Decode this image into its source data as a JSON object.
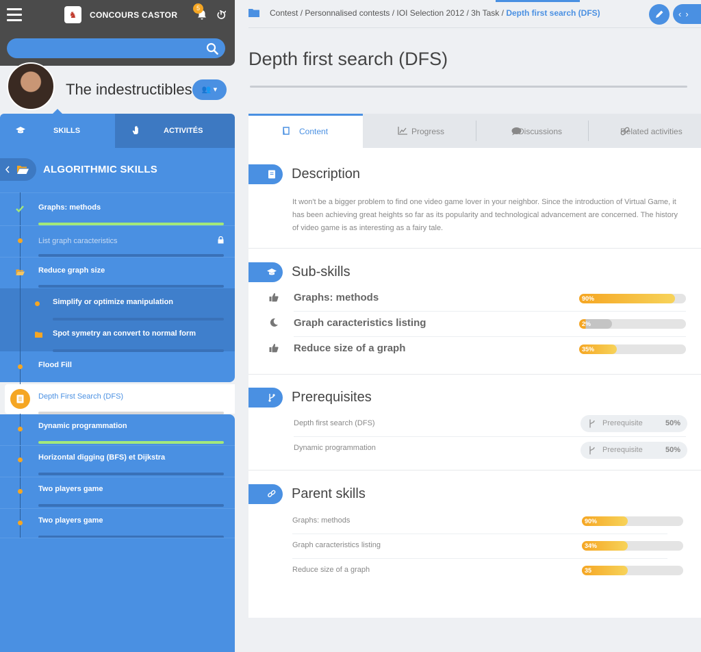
{
  "app": {
    "brand": "CONCOURS CASTOR",
    "notifications": "5"
  },
  "search": {
    "placeholder": ""
  },
  "team": {
    "name": "The indestructibles"
  },
  "side_tabs": {
    "skills": "SKILLS",
    "activities": "ACTIVITÉS"
  },
  "skill_tree": {
    "title": "ALGORITHMIC SKILLS",
    "items": [
      {
        "label": "Graphs: methods",
        "progress": 1.0,
        "state": "done"
      },
      {
        "label": "List graph caracteristics",
        "progress": 0.0,
        "state": "locked"
      },
      {
        "label": "Reduce graph size",
        "progress": 0.0,
        "state": "folder"
      },
      {
        "label": "Simplify or optimize manipulation",
        "progress": 0.0,
        "state": "child"
      },
      {
        "label": "Spot symetry an convert to normal form",
        "progress": 0.0,
        "state": "child-folder"
      },
      {
        "label": "Flood Fill",
        "progress": 0.0,
        "state": "normal"
      },
      {
        "label": "Depth First Search (DFS)",
        "progress": 0.0,
        "state": "active"
      },
      {
        "label": "Dynamic programmation",
        "progress": 1.0,
        "state": "normal"
      },
      {
        "label": "Horizontal digging (BFS) et Dijkstra",
        "progress": 0.0,
        "state": "normal"
      },
      {
        "label": "Two players game",
        "progress": 0.0,
        "state": "normal"
      },
      {
        "label": "Two players game",
        "progress": 0.0,
        "state": "normal"
      }
    ]
  },
  "breadcrumb": {
    "path": "Contest / Personnalised contests / IOI Selection 2012 / 3h Task / ",
    "current": "Depth first search (DFS)"
  },
  "page": {
    "title": "Depth first search (DFS)"
  },
  "tabs": [
    "Content",
    "Progress",
    "Discussions",
    "Related activities"
  ],
  "description": {
    "title": "Description",
    "text": "It won't be a bigger problem to find one video game lover in your neighbor. Since the introduction of Virtual Game, it has been achieving great heights so far as its popularity and technological advancement are concerned. The history of video game is as interesting as a fairy tale."
  },
  "subskills": {
    "title": "Sub-skills",
    "items": [
      {
        "name": "Graphs: methods",
        "label": "90%",
        "progress": 0.9,
        "icon": "thumbs-up-icon"
      },
      {
        "name": "Graph caracteristics listing",
        "label": "2%",
        "progress": 0.02,
        "icon": "moon-icon"
      },
      {
        "name": "Reduce size of a graph",
        "label": "35%",
        "progress": 0.35,
        "icon": "thumbs-up-icon"
      }
    ]
  },
  "prerequisites": {
    "title": "Prerequisites",
    "items": [
      {
        "name": "Depth first search (DFS)",
        "tag": "Prerequisite",
        "value": "50%"
      },
      {
        "name": "Dynamic programmation",
        "tag": "Prerequisite",
        "value": "50%"
      }
    ]
  },
  "parents": {
    "title": "Parent skills",
    "items": [
      {
        "name": "Graphs: methods",
        "label": "90%",
        "progress": 0.45
      },
      {
        "name": "Graph caracteristics listing",
        "label": "34%",
        "progress": 0.45
      },
      {
        "name": "Reduce size of a graph",
        "label": "35",
        "progress": 0.45
      }
    ]
  },
  "colors": {
    "primary": "#4a90e2",
    "accent": "#f5a623",
    "success": "#a3e87a",
    "topbar": "#4b4b4b"
  }
}
